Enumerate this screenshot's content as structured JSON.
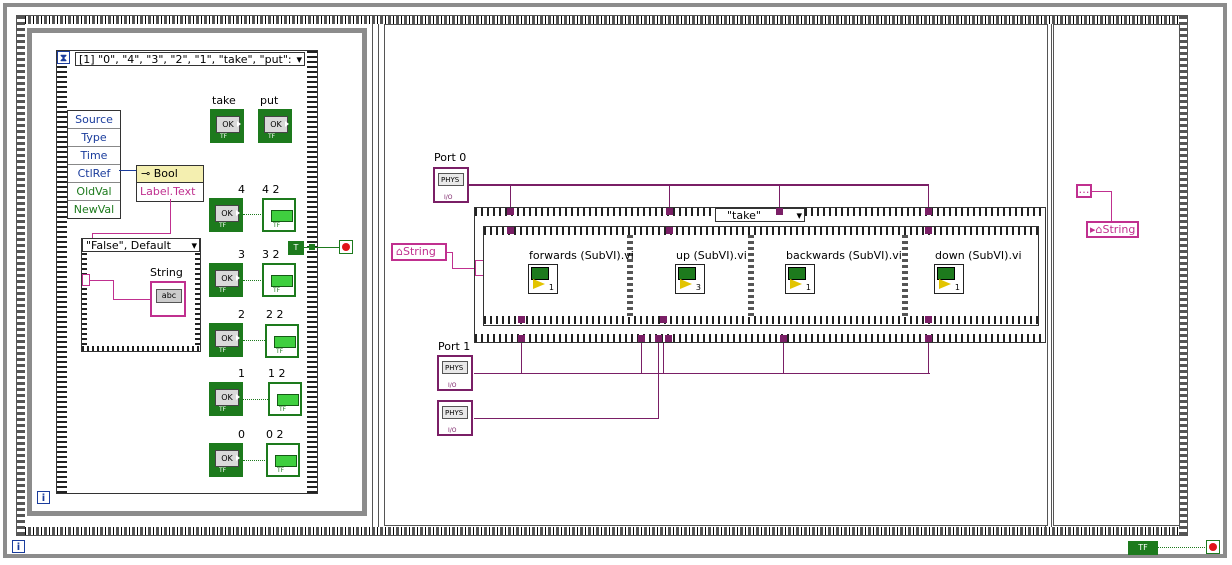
{
  "event_structure": {
    "selector": "[1] \"0\", \"4\", \"3\", \"2\", \"1\", \"take\", \"put\":",
    "event_data_fields": [
      "Source",
      "Type",
      "Time",
      "CtlRef",
      "OldVal",
      "NewVal"
    ],
    "property_node": {
      "class": "Bool",
      "property": "Label.Text"
    },
    "inner_case": {
      "selector": "\"False\", Default",
      "indicator_label": "String",
      "indicator_text": "abc"
    }
  },
  "controls": {
    "take": "take",
    "put": "put",
    "c4": "4",
    "i4": "4 2",
    "c3": "3",
    "i3": "3 2",
    "c2": "2",
    "i2": "2 2",
    "c1": "1",
    "i1": "1 2",
    "c0": "0",
    "i0": "0 2",
    "ok_text": "OK",
    "tf_text": "TF",
    "t_const": "T"
  },
  "iteration_terminal": "i",
  "middle_frame": {
    "port0_label": "Port 0",
    "port1_label": "Port 1",
    "phys_text": "PHYS",
    "io_text": "I/O",
    "string_local": "String",
    "case_selector": "\"take\"",
    "subvis": [
      {
        "name": "forwards (SubVI).vi",
        "num": "1"
      },
      {
        "name": "up (SubVI).vi",
        "num": "3"
      },
      {
        "name": "backwards (SubVI).vi",
        "num": "1"
      },
      {
        "name": "down (SubVI).vi",
        "num": "1"
      }
    ]
  },
  "right_frame": {
    "empty_const": "…",
    "string_local": "String"
  },
  "bottom": {
    "tf_text": "TF"
  },
  "colors": {
    "boolean_green": "#1d7a1d",
    "string_pink": "#c0308f",
    "daqmx_purple": "#7a1f66",
    "loop_gray": "#8c8c8c"
  }
}
